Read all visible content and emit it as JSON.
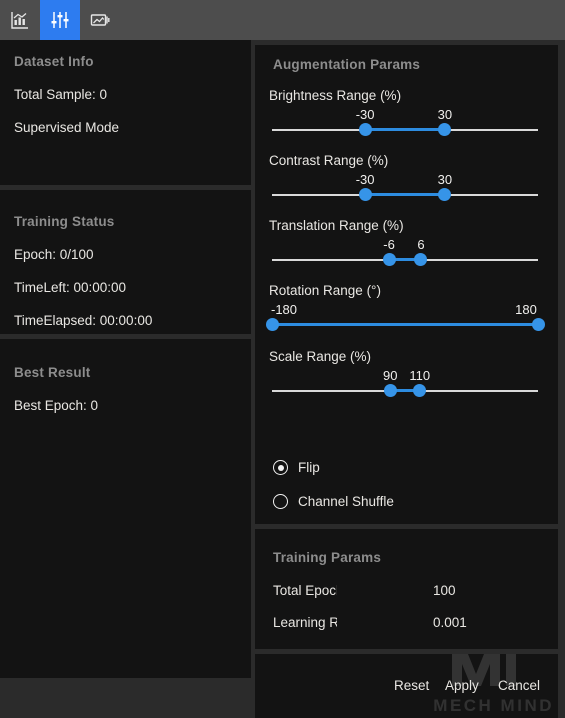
{
  "toolbar": {
    "items": [
      {
        "name": "chart-icon",
        "label": "Training Chart",
        "active": false
      },
      {
        "name": "sliders-icon",
        "label": "Training Params",
        "active": true
      },
      {
        "name": "image-icon",
        "label": "Image Preview",
        "active": false
      }
    ],
    "active_color": "#2d7cf0",
    "background": "#4d4d4d"
  },
  "left_panel": {
    "dataset_info": {
      "title": "Dataset Info",
      "rows": [
        "Total Sample: 0",
        "Supervised Mode"
      ]
    },
    "training_status": {
      "title": "Training Status",
      "rows": [
        "Epoch: 0/100",
        "TimeLeft: 00:00:00",
        "TimeElapsed: 00:00:00"
      ]
    },
    "best_result": {
      "title": "Best Result",
      "rows": [
        "Best Epoch: 0"
      ]
    }
  },
  "augmentation": {
    "title": "Augmentation Params",
    "accent_color": "#3694e8",
    "sliders": [
      {
        "name": "brightness-range",
        "label": "Brightness Range (%)",
        "min_label": "-30",
        "max_label": "30",
        "min": -30,
        "max": 30,
        "range_min": -100,
        "range_max": 100
      },
      {
        "name": "contrast-range",
        "label": "Contrast Range (%)",
        "min_label": "-30",
        "max_label": "30",
        "min": -30,
        "max": 30,
        "range_min": -100,
        "range_max": 100
      },
      {
        "name": "translation-range",
        "label": "Translation Range   (%)",
        "min_label": "-6",
        "max_label": "6",
        "min": -6,
        "max": 6,
        "range_min": -50,
        "range_max": 50
      },
      {
        "name": "rotation-range",
        "label": "Rotation Range (°)",
        "min_label": "-180",
        "max_label": "180",
        "min": -180,
        "max": 180,
        "range_min": -180,
        "range_max": 180
      },
      {
        "name": "scale-range",
        "label": "Scale Range (%)",
        "min_label": "90",
        "max_label": "110",
        "min": 90,
        "max": 110,
        "range_min": 10,
        "range_max": 190
      }
    ],
    "options": [
      {
        "name": "flip",
        "label": "Flip",
        "checked": true
      },
      {
        "name": "channel-shuffle",
        "label": "Channel Shuffle",
        "checked": false
      }
    ]
  },
  "training_params": {
    "title": "Training Params",
    "rows": [
      {
        "label": "Total Epochs",
        "value": "100"
      },
      {
        "label": "Learning Rate",
        "value": "0.001"
      }
    ]
  },
  "actions": {
    "reset": "Reset",
    "apply": "Apply",
    "cancel": "Cancel"
  },
  "watermark": {
    "text": "MECH MIND"
  }
}
